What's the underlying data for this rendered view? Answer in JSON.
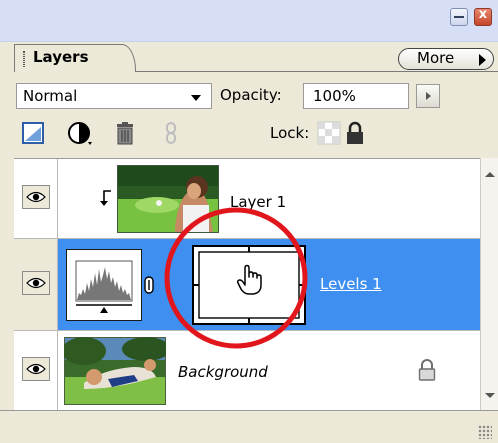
{
  "panel": {
    "tab_label": "Layers",
    "more_label": "More"
  },
  "controls": {
    "blend_mode": "Normal",
    "opacity_label": "Opacity:",
    "opacity_value": "100%",
    "lock_label": "Lock:"
  },
  "layers": [
    {
      "name": "Layer 1",
      "visible": true,
      "clipped": true,
      "selected": false
    },
    {
      "name": "Levels 1",
      "visible": true,
      "selected": true,
      "has_mask": true
    },
    {
      "name": "Background",
      "visible": true,
      "locked": true,
      "selected": false
    }
  ],
  "colors": {
    "selection": "#3f8ff0",
    "annotation_circle": "#e0161c",
    "panel_bg": "#ece9d8"
  },
  "icons": [
    "minimize-icon",
    "close-icon",
    "more-arrow-icon",
    "new-fill-layer-icon",
    "adjustment-layer-icon",
    "trash-icon",
    "link-icon",
    "lock-transparency-icon",
    "lock-all-icon",
    "eye-icon",
    "clip-arrow-icon",
    "levels-histogram-icon",
    "chain-link-icon",
    "hand-cursor-icon",
    "padlock-icon"
  ]
}
